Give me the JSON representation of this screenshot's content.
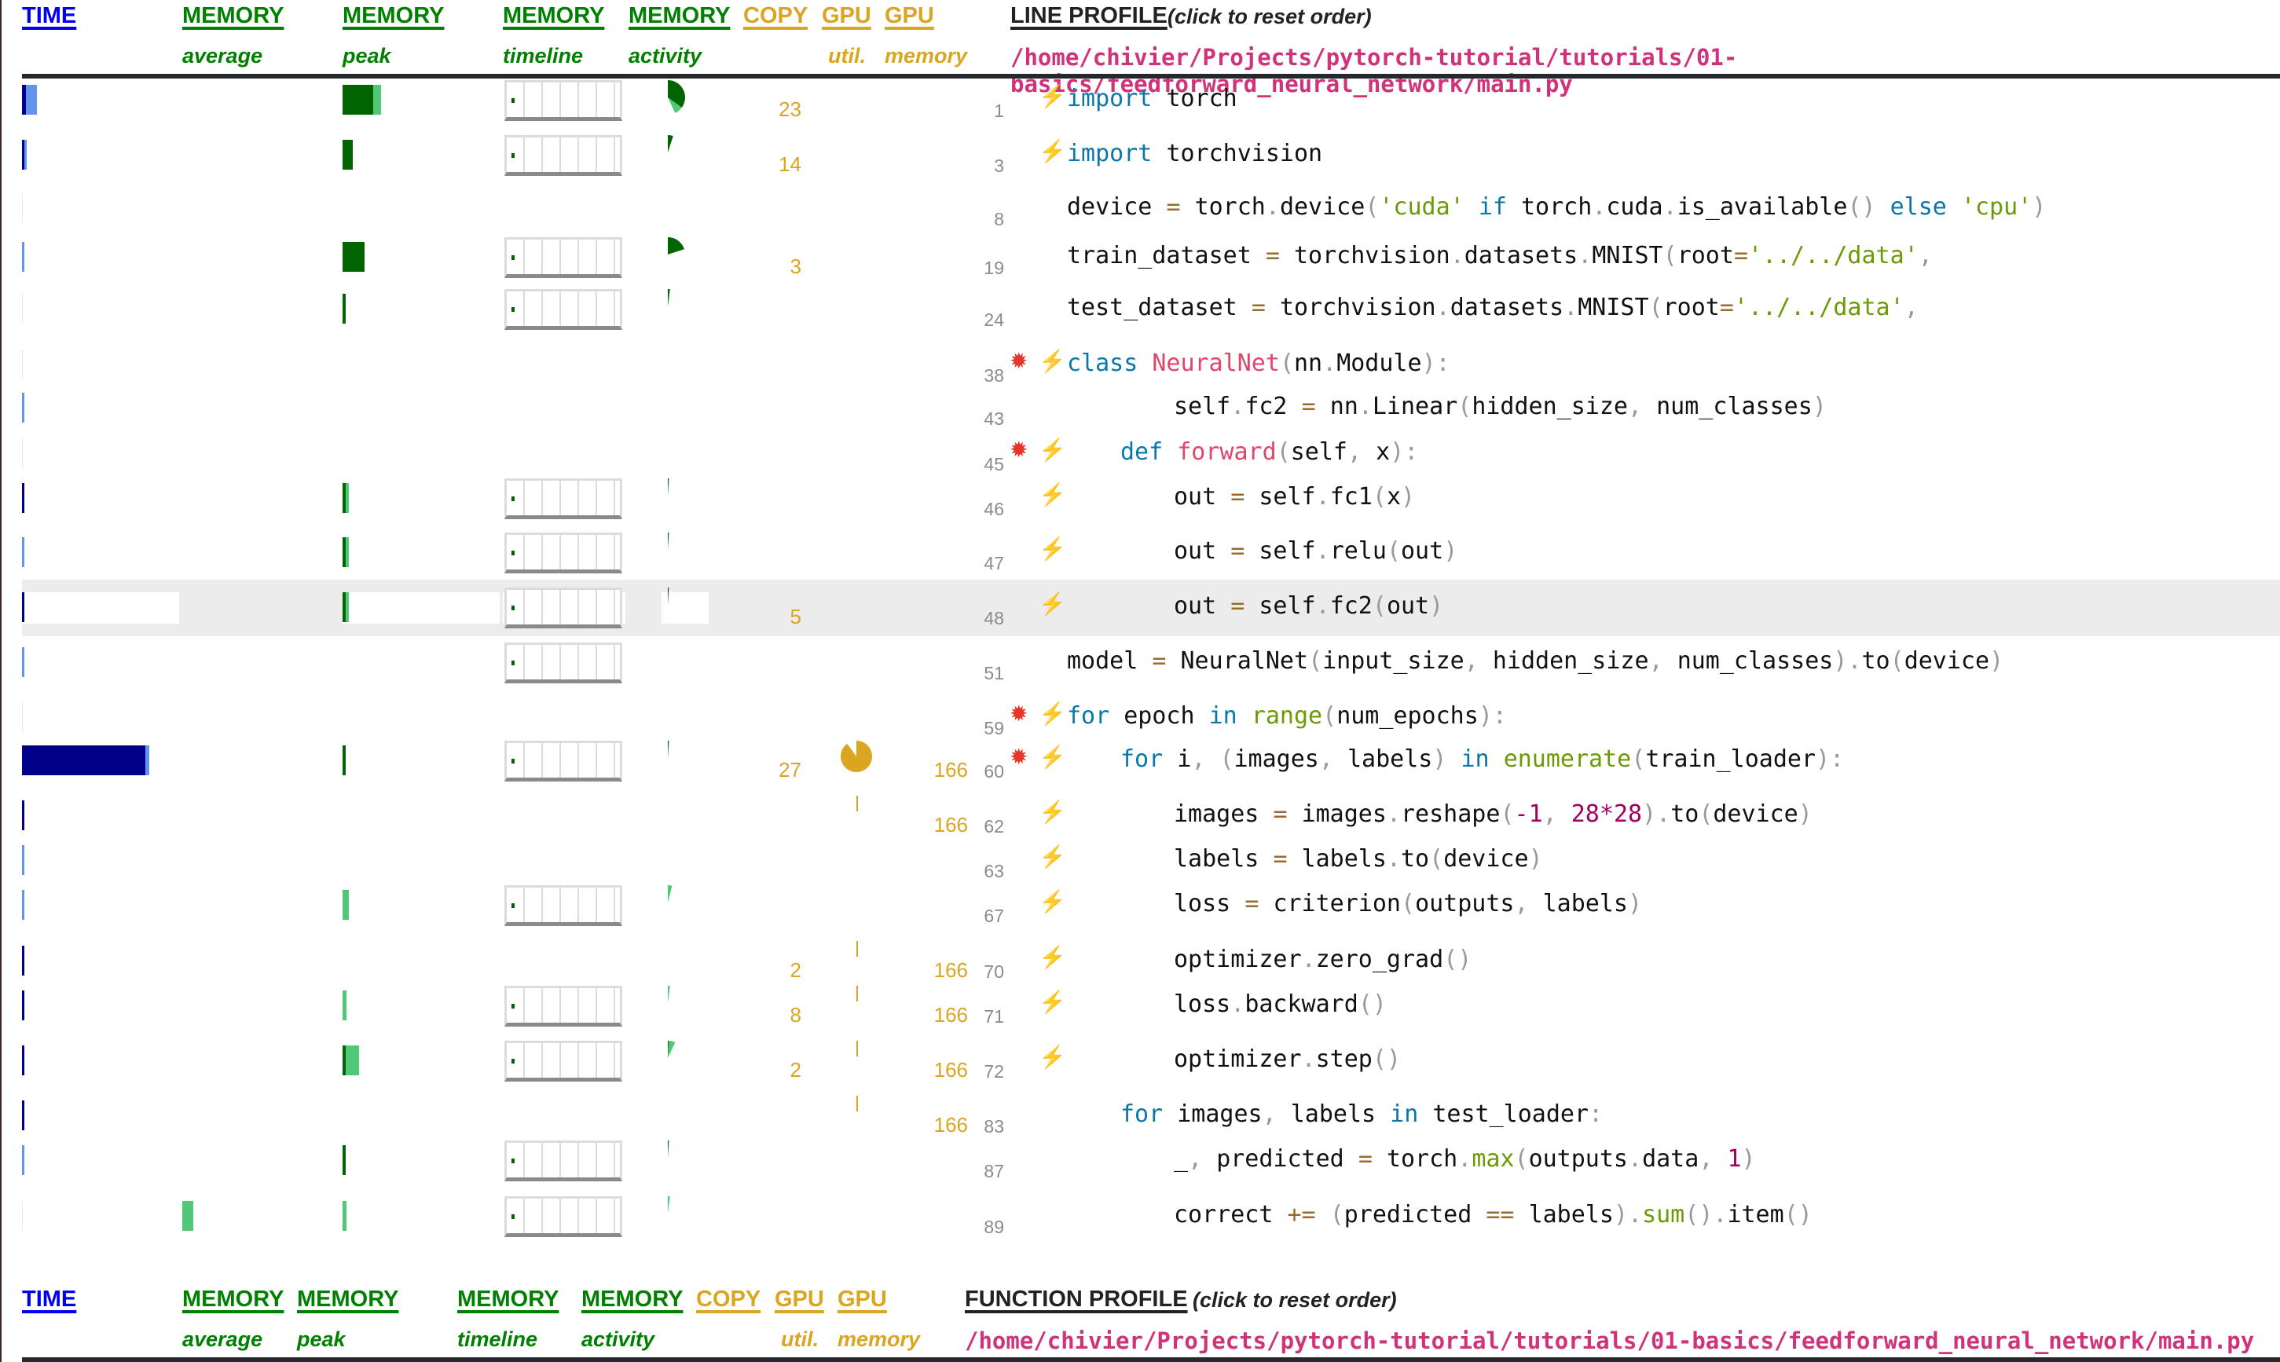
{
  "line_profile": {
    "headers": [
      {
        "id": "time",
        "label": "TIME",
        "sub": ""
      },
      {
        "id": "mem_avg",
        "label": "MEMORY",
        "sub": "average"
      },
      {
        "id": "mem_peak",
        "label": "MEMORY",
        "sub": "peak"
      },
      {
        "id": "mem_timeline",
        "label": "MEMORY",
        "sub": "timeline"
      },
      {
        "id": "mem_activity",
        "label": "MEMORY",
        "sub": "activity"
      },
      {
        "id": "copy",
        "label": "COPY",
        "sub": ""
      },
      {
        "id": "gpu_util",
        "label": "GPU",
        "sub": "util."
      },
      {
        "id": "gpu_mem",
        "label": "GPU",
        "sub": "memory"
      }
    ],
    "title": "LINE PROFILE",
    "title_note": "(click to reset order)",
    "file_path": "/home/chivier/Projects/pytorch-tutorial/tutorials/01-basics/feedforward_neural_network/main.py",
    "rows": [
      {
        "line": "1",
        "copy": "23",
        "gpu_mem": "",
        "code": "import torch",
        "indent": 0,
        "bolt": true,
        "boom": false
      },
      {
        "line": "3",
        "copy": "14",
        "gpu_mem": "",
        "code": "import torchvision",
        "indent": 0,
        "bolt": true,
        "boom": false
      },
      {
        "line": "8",
        "copy": "",
        "gpu_mem": "",
        "code": "device = torch.device('cuda' if torch.cuda.is_available() else 'cpu')",
        "indent": 0,
        "bolt": false,
        "boom": false
      },
      {
        "line": "19",
        "copy": "3",
        "gpu_mem": "",
        "code": "train_dataset = torchvision.datasets.MNIST(root='../../data',",
        "indent": 0,
        "bolt": false,
        "boom": false
      },
      {
        "line": "24",
        "copy": "",
        "gpu_mem": "",
        "code": "test_dataset = torchvision.datasets.MNIST(root='../../data',",
        "indent": 0,
        "bolt": false,
        "boom": false
      },
      {
        "line": "38",
        "copy": "",
        "gpu_mem": "",
        "code": "class NeuralNet(nn.Module):",
        "indent": 0,
        "bolt": true,
        "boom": true
      },
      {
        "line": "43",
        "copy": "",
        "gpu_mem": "",
        "code": "self.fc2 = nn.Linear(hidden_size, num_classes)",
        "indent": 2,
        "bolt": false,
        "boom": false
      },
      {
        "line": "45",
        "copy": "",
        "gpu_mem": "",
        "code": "def forward(self, x):",
        "indent": 1,
        "bolt": true,
        "boom": true
      },
      {
        "line": "46",
        "copy": "",
        "gpu_mem": "",
        "code": "out = self.fc1(x)",
        "indent": 2,
        "bolt": true,
        "boom": false
      },
      {
        "line": "47",
        "copy": "",
        "gpu_mem": "",
        "code": "out = self.relu(out)",
        "indent": 2,
        "bolt": true,
        "boom": false
      },
      {
        "line": "48",
        "copy": "5",
        "gpu_mem": "",
        "code": "out = self.fc2(out)",
        "indent": 2,
        "bolt": true,
        "boom": false,
        "highlight": true
      },
      {
        "line": "51",
        "copy": "",
        "gpu_mem": "",
        "code": "model = NeuralNet(input_size, hidden_size, num_classes).to(device)",
        "indent": 0,
        "bolt": false,
        "boom": false
      },
      {
        "line": "59",
        "copy": "",
        "gpu_mem": "",
        "code": "for epoch in range(num_epochs):",
        "indent": 0,
        "bolt": true,
        "boom": true
      },
      {
        "line": "60",
        "copy": "27",
        "gpu_mem": "166",
        "code": "for i, (images, labels) in enumerate(train_loader):",
        "indent": 1,
        "bolt": true,
        "boom": true
      },
      {
        "line": "62",
        "copy": "",
        "gpu_mem": "166",
        "code": "images = images.reshape(-1, 28*28).to(device)",
        "indent": 2,
        "bolt": true,
        "boom": false
      },
      {
        "line": "63",
        "copy": "",
        "gpu_mem": "",
        "code": "labels = labels.to(device)",
        "indent": 2,
        "bolt": true,
        "boom": false
      },
      {
        "line": "67",
        "copy": "",
        "gpu_mem": "",
        "code": "loss = criterion(outputs, labels)",
        "indent": 2,
        "bolt": true,
        "boom": false
      },
      {
        "line": "70",
        "copy": "2",
        "gpu_mem": "166",
        "code": "optimizer.zero_grad()",
        "indent": 2,
        "bolt": true,
        "boom": false
      },
      {
        "line": "71",
        "copy": "8",
        "gpu_mem": "166",
        "code": "loss.backward()",
        "indent": 2,
        "bolt": true,
        "boom": false
      },
      {
        "line": "72",
        "copy": "2",
        "gpu_mem": "166",
        "code": "optimizer.step()",
        "indent": 2,
        "bolt": true,
        "boom": false
      },
      {
        "line": "83",
        "copy": "",
        "gpu_mem": "166",
        "code": "for images, labels in test_loader:",
        "indent": 1,
        "bolt": false,
        "boom": false
      },
      {
        "line": "87",
        "copy": "",
        "gpu_mem": "",
        "code": "_, predicted = torch.max(outputs.data, 1)",
        "indent": 2,
        "bolt": false,
        "boom": false
      },
      {
        "line": "89",
        "copy": "",
        "gpu_mem": "",
        "code": "correct += (predicted == labels).sum().item()",
        "indent": 2,
        "bolt": false,
        "boom": false
      }
    ],
    "metrics": [
      {
        "time_python": 0.02,
        "time_native": 0.05,
        "mem_avg": 0,
        "peak_py": 0.55,
        "peak_native": 0.15,
        "timeline": true,
        "activity": 0.35,
        "activity_native": 0.08,
        "gpu_util": 0
      },
      {
        "time_python": 0.01,
        "time_native": 0.01,
        "mem_avg": 0,
        "peak_py": 0.18,
        "peak_native": 0.0,
        "timeline": true,
        "activity": 0.05,
        "activity_native": 0,
        "gpu_util": 0
      },
      {
        "time_python": 0,
        "time_native": 0,
        "mem_avg": 0,
        "peak_py": 0,
        "peak_native": 0,
        "timeline": false,
        "activity": 0,
        "activity_native": 0,
        "gpu_util": 0
      },
      {
        "time_python": 0,
        "time_native": 0.003,
        "mem_avg": 0,
        "peak_py": 0.4,
        "peak_native": 0,
        "timeline": true,
        "activity": 0.2,
        "activity_native": 0,
        "gpu_util": 0
      },
      {
        "time_python": 0,
        "time_native": 0,
        "mem_avg": 0,
        "peak_py": 0.05,
        "peak_native": 0,
        "timeline": true,
        "activity": 0.02,
        "activity_native": 0,
        "gpu_util": 0
      },
      {
        "time_python": 0,
        "time_native": 0,
        "mem_avg": 0,
        "peak_py": 0,
        "peak_native": 0,
        "timeline": false,
        "activity": 0,
        "activity_native": 0,
        "gpu_util": 0
      },
      {
        "time_python": 0,
        "time_native": 0.003,
        "mem_avg": 0,
        "peak_py": 0,
        "peak_native": 0,
        "timeline": false,
        "activity": 0,
        "activity_native": 0,
        "gpu_util": 0
      },
      {
        "time_python": 0,
        "time_native": 0,
        "mem_avg": 0,
        "peak_py": 0,
        "peak_native": 0,
        "timeline": false,
        "activity": 0,
        "activity_native": 0,
        "gpu_util": 0
      },
      {
        "time_python": 0.003,
        "time_native": 0,
        "mem_avg": 0,
        "peak_py": 0.03,
        "peak_native": 0.01,
        "timeline": true,
        "activity": 0.01,
        "activity_native": 0,
        "gpu_util": 0
      },
      {
        "time_python": 0,
        "time_native": 0.003,
        "mem_avg": 0,
        "peak_py": 0.03,
        "peak_native": 0.02,
        "timeline": true,
        "activity": 0.01,
        "activity_native": 0,
        "gpu_util": 0
      },
      {
        "time_python": 0.003,
        "time_native": 0,
        "mem_avg": 0,
        "peak_py": 0.02,
        "peak_native": 0.01,
        "timeline": true,
        "activity": 0.01,
        "activity_native": 0,
        "gpu_util": 0
      },
      {
        "time_python": 0,
        "time_native": 0.003,
        "mem_avg": 0,
        "peak_py": 0,
        "peak_native": 0,
        "timeline": true,
        "activity": 0,
        "activity_native": 0,
        "gpu_util": 0
      },
      {
        "time_python": 0,
        "time_native": 0,
        "mem_avg": 0,
        "peak_py": 0,
        "peak_native": 0,
        "timeline": false,
        "activity": 0,
        "activity_native": 0,
        "gpu_util": 0
      },
      {
        "time_python": 0.58,
        "time_native": 0.02,
        "mem_avg": 0,
        "peak_py": 0.03,
        "peak_native": 0,
        "timeline": true,
        "activity": 0.01,
        "activity_native": 0,
        "gpu_util": 0.9
      },
      {
        "time_python": 0.005,
        "time_native": 0,
        "mem_avg": 0,
        "peak_py": 0,
        "peak_native": 0,
        "timeline": false,
        "activity": 0,
        "activity_native": 0,
        "gpu_util": 0.01
      },
      {
        "time_python": 0,
        "time_native": 0.003,
        "mem_avg": 0,
        "peak_py": 0,
        "peak_native": 0,
        "timeline": false,
        "activity": 0,
        "activity_native": 0,
        "gpu_util": 0
      },
      {
        "time_python": 0,
        "time_native": 0.003,
        "mem_avg": 0,
        "peak_py": 0,
        "peak_native": 0.12,
        "timeline": true,
        "activity": 0,
        "activity_native": 0.04,
        "gpu_util": 0
      },
      {
        "time_python": 0.005,
        "time_native": 0,
        "mem_avg": 0,
        "peak_py": 0,
        "peak_native": 0,
        "timeline": false,
        "activity": 0,
        "activity_native": 0,
        "gpu_util": 0.01
      },
      {
        "time_python": 0.01,
        "time_native": 0,
        "mem_avg": 0,
        "peak_py": 0,
        "peak_native": 0.07,
        "timeline": true,
        "activity": 0,
        "activity_native": 0.02,
        "gpu_util": 0.01
      },
      {
        "time_python": 0.008,
        "time_native": 0,
        "mem_avg": 0,
        "peak_py": 0.02,
        "peak_native": 0.24,
        "timeline": true,
        "activity": 0.01,
        "activity_native": 0.06,
        "gpu_util": 0.01
      },
      {
        "time_python": 0.01,
        "time_native": 0,
        "mem_avg": 0,
        "peak_py": 0,
        "peak_native": 0,
        "timeline": false,
        "activity": 0,
        "activity_native": 0,
        "gpu_util": 0.01
      },
      {
        "time_python": 0,
        "time_native": 0.002,
        "mem_avg": 0,
        "peak_py": 0.03,
        "peak_native": 0,
        "timeline": true,
        "activity": 0.01,
        "activity_native": 0,
        "gpu_util": 0
      },
      {
        "time_python": 0,
        "time_native": 0,
        "mem_avg": 0.07,
        "mem_avg_native": true,
        "peak_py": 0,
        "peak_native": 0.07,
        "timeline": true,
        "activity": 0,
        "activity_native": 0.02,
        "gpu_util": 0
      }
    ]
  },
  "function_profile": {
    "headers": [
      {
        "id": "time",
        "label": "TIME",
        "sub": ""
      },
      {
        "id": "mem_avg",
        "label": "MEMORY",
        "sub": "average"
      },
      {
        "id": "mem_peak",
        "label": "MEMORY",
        "sub": "peak"
      },
      {
        "id": "mem_timeline",
        "label": "MEMORY",
        "sub": "timeline"
      },
      {
        "id": "mem_activity",
        "label": "MEMORY",
        "sub": "activity"
      },
      {
        "id": "copy",
        "label": "COPY",
        "sub": ""
      },
      {
        "id": "gpu_util",
        "label": "GPU",
        "sub": "util."
      },
      {
        "id": "gpu_mem",
        "label": "GPU",
        "sub": "memory"
      }
    ],
    "title": "FUNCTION PROFILE",
    "title_note": "(click to reset order)",
    "file_path": "/home/chivier/Projects/pytorch-tutorial/tutorials/01-basics/feedforward_neural_network/main.py"
  },
  "colors": {
    "time_python": "#00008b",
    "time_native": "#6495ed",
    "mem_python": "#006400",
    "mem_native": "#50c878",
    "gpu": "#daa520",
    "path": "#d0337a",
    "header_time": "#0000ee",
    "header_memory": "#008000",
    "header_gpu": "#daa520"
  }
}
